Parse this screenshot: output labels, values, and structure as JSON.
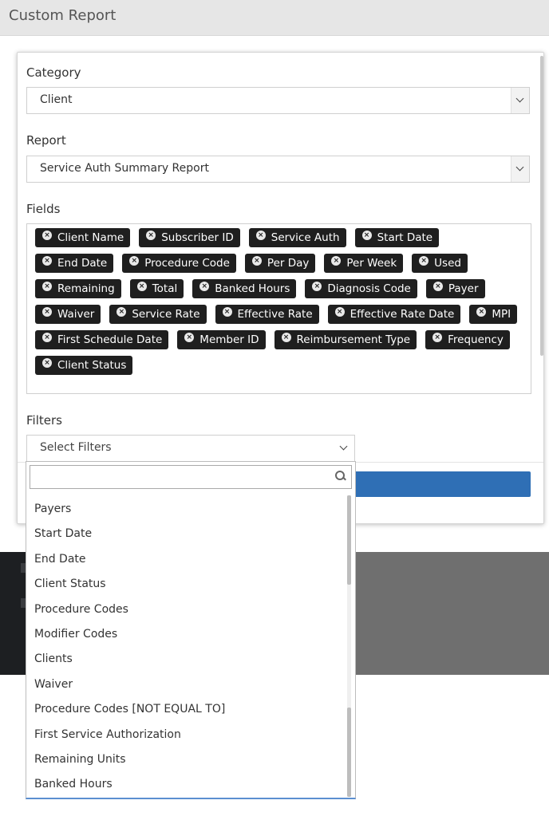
{
  "window": {
    "title": "Custom Report"
  },
  "form": {
    "category": {
      "label": "Category",
      "value": "Client"
    },
    "report": {
      "label": "Report",
      "value": "Service Auth Summary Report"
    },
    "fields": {
      "label": "Fields",
      "tags": [
        "Client Name",
        "Subscriber ID",
        "Service Auth",
        "Start Date",
        "End Date",
        "Procedure Code",
        "Per Day",
        "Per Week",
        "Used",
        "Remaining",
        "Total",
        "Banked Hours",
        "Diagnosis Code",
        "Payer",
        "Waiver",
        "Service Rate",
        "Effective Rate",
        "Effective Rate Date",
        "MPI",
        "First Schedule Date",
        "Member ID",
        "Reimbursement Type",
        "Frequency",
        "Client Status"
      ],
      "remove_glyph": "×"
    },
    "filters": {
      "label": "Filters",
      "placeholder": "Select Filters",
      "search_placeholder": "",
      "options": [
        "Payers",
        "Start Date",
        "End Date",
        "Client Status",
        "Procedure Codes",
        "Modifier Codes",
        "Clients",
        "Waiver",
        "Procedure Codes [NOT EQUAL TO]",
        "First Service Authorization",
        "Remaining Units",
        "Banked Hours"
      ]
    }
  },
  "icons": {
    "select_arrow": "chevron-down-icon",
    "tag_remove": "close-circle-icon",
    "search": "search-icon"
  },
  "colors": {
    "tag_bg": "#1f1f1f",
    "primary": "#2f6fb5",
    "dropdown_focus": "#5b8fd1"
  }
}
